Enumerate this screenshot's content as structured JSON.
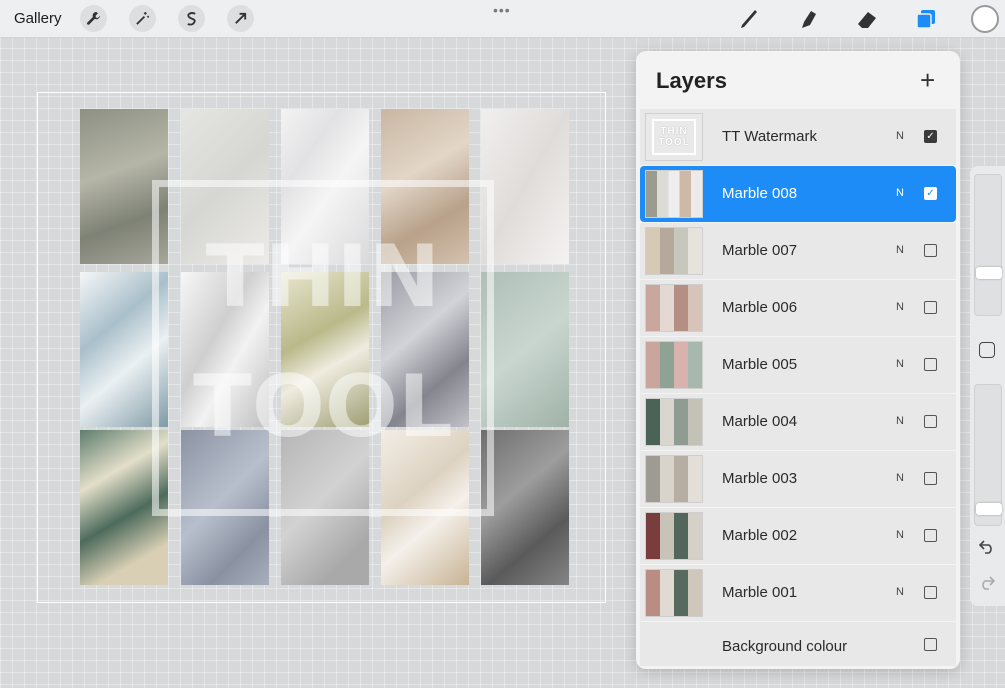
{
  "topbar": {
    "gallery_label": "Gallery",
    "left_tools": [
      "wrench-icon",
      "magic-wand-icon",
      "selection-icon",
      "transform-arrow-icon"
    ],
    "right_tools": [
      "brush-icon",
      "smudge-icon",
      "eraser-icon",
      "layers-icon"
    ],
    "more_dots": "•••",
    "accent_color": "#1e8cf6"
  },
  "canvas": {
    "watermark_line1": "THIN",
    "watermark_line2": "TOOL"
  },
  "layers_panel": {
    "title": "Layers",
    "add_symbol": "+",
    "layers": [
      {
        "name": "TT Watermark",
        "blend": "N",
        "visible": true,
        "active": false
      },
      {
        "name": "Marble 008",
        "blend": "N",
        "visible": true,
        "active": true
      },
      {
        "name": "Marble 007",
        "blend": "N",
        "visible": false,
        "active": false
      },
      {
        "name": "Marble 006",
        "blend": "N",
        "visible": false,
        "active": false
      },
      {
        "name": "Marble 005",
        "blend": "N",
        "visible": false,
        "active": false
      },
      {
        "name": "Marble 004",
        "blend": "N",
        "visible": false,
        "active": false
      },
      {
        "name": "Marble 003",
        "blend": "N",
        "visible": false,
        "active": false
      },
      {
        "name": "Marble 002",
        "blend": "N",
        "visible": false,
        "active": false
      },
      {
        "name": "Marble 001",
        "blend": "N",
        "visible": false,
        "active": false
      }
    ],
    "background": {
      "name": "Background colour",
      "visible": false
    },
    "thumb_logo_line1": "THIN",
    "thumb_logo_line2": "TOOL"
  },
  "sidebar": {
    "undo_icon": "undo-icon",
    "redo_icon": "redo-icon"
  }
}
